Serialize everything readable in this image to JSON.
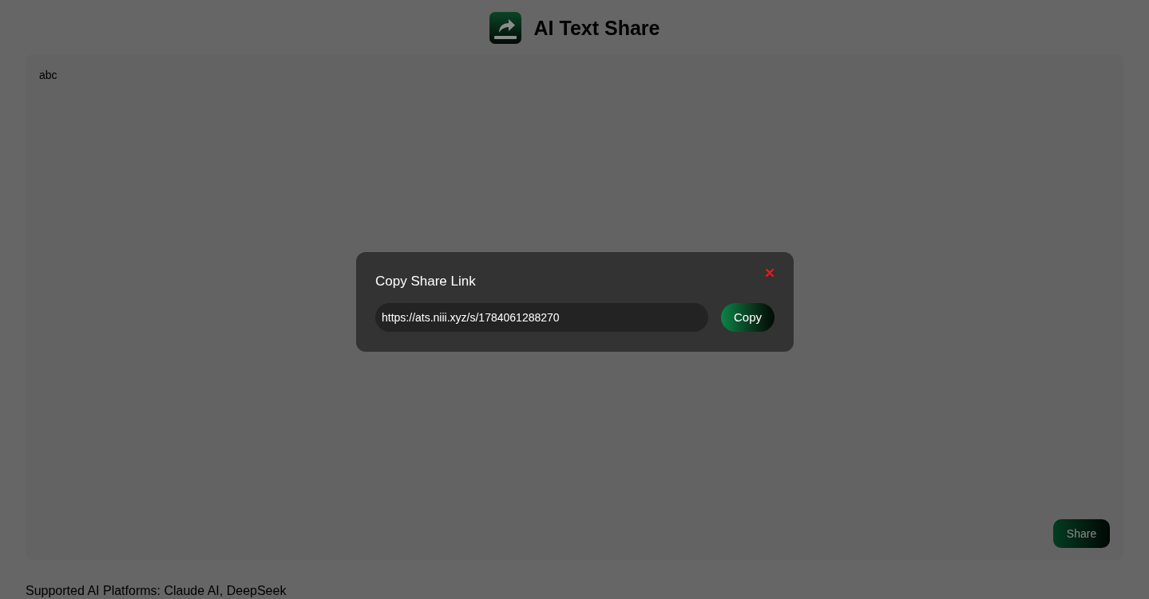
{
  "header": {
    "title": "AI Text Share"
  },
  "editor": {
    "value": "abc"
  },
  "share_button": {
    "label": "Share"
  },
  "footer": {
    "text": "Supported AI Platforms: Claude AI, DeepSeek"
  },
  "modal": {
    "title": "Copy Share Link",
    "link": "https://ats.niii.xyz/s/1784061288270",
    "copy_button": "Copy"
  }
}
